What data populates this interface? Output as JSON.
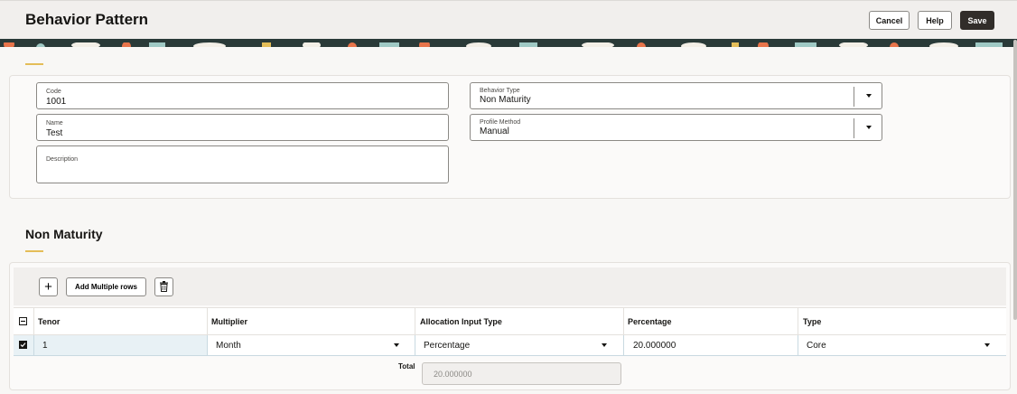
{
  "header": {
    "title": "Behavior Pattern",
    "cancel_label": "Cancel",
    "help_label": "Help",
    "save_label": "Save"
  },
  "form": {
    "code": {
      "label": "Code",
      "value": "1001"
    },
    "name": {
      "label": "Name",
      "value": "Test"
    },
    "description": {
      "label": "Description",
      "value": ""
    },
    "behavior_type": {
      "label": "Behavior Type",
      "value": "Non Maturity"
    },
    "profile_method": {
      "label": "Profile Method",
      "value": "Manual"
    }
  },
  "section": {
    "title": "Non Maturity"
  },
  "toolbar": {
    "add_icon": "plus-icon",
    "add_multiple_label": "Add Multiple rows",
    "delete_icon": "trash-icon"
  },
  "table": {
    "columns": [
      "Tenor",
      "Multiplier",
      "Allocation Input Type",
      "Percentage",
      "Type"
    ],
    "rows": [
      {
        "selected": true,
        "tenor": "1",
        "multiplier": "Month",
        "allocation_input_type": "Percentage",
        "percentage": "20.000000",
        "type": "Core"
      }
    ],
    "total_label": "Total",
    "total_value": "20.000000"
  },
  "colors": {
    "accent": "#e4bd58",
    "save_button": "#312d2a",
    "selected_row": "#e8f1f5"
  }
}
